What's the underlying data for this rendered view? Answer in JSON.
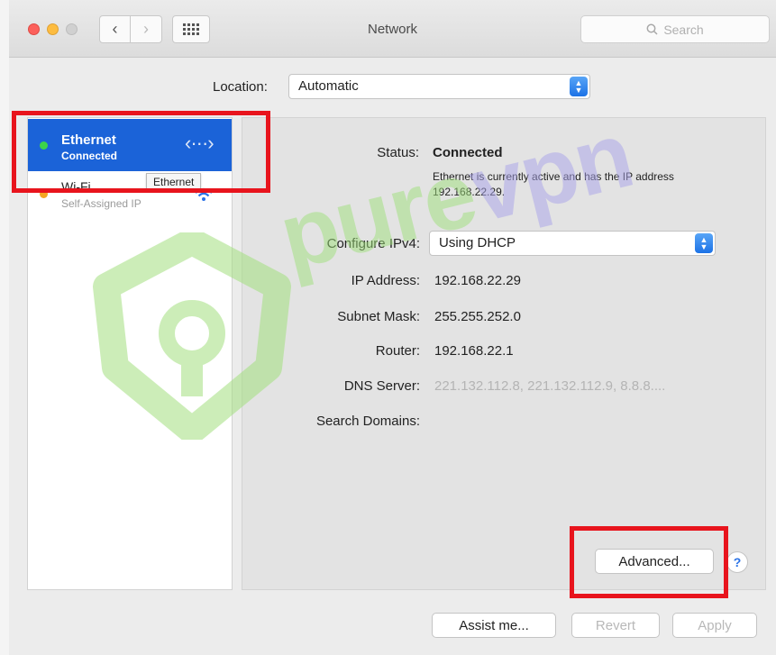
{
  "window": {
    "title": "Network"
  },
  "search": {
    "placeholder": "Search",
    "icon": "search-icon"
  },
  "location": {
    "label": "Location:",
    "value": "Automatic"
  },
  "services": [
    {
      "name": "Ethernet",
      "status": "Connected",
      "status_color": "#3cd44a",
      "icon": "ethernet-icon",
      "selected": true
    },
    {
      "name": "Wi-Fi",
      "status": "Self-Assigned IP",
      "status_color": "#f5a623",
      "icon": "wifi-icon",
      "selected": false
    }
  ],
  "tooltip": {
    "text": "Ethernet"
  },
  "details": {
    "status_label": "Status:",
    "status_value": "Connected",
    "status_description": "Ethernet is currently active and has the IP address 192.168.22.29.",
    "configure_label": "Configure IPv4:",
    "configure_value": "Using DHCP",
    "ip_label": "IP Address:",
    "ip_value": "192.168.22.29",
    "subnet_label": "Subnet Mask:",
    "subnet_value": "255.255.252.0",
    "router_label": "Router:",
    "router_value": "192.168.22.1",
    "dns_label": "DNS Server:",
    "dns_value": "221.132.112.8, 221.132.112.9, 8.8.8....",
    "search_domains_label": "Search Domains:"
  },
  "buttons": {
    "advanced": "Advanced...",
    "help": "?",
    "assist": "Assist me...",
    "revert": "Revert",
    "apply": "Apply"
  },
  "watermark": {
    "part1": "pure",
    "part2": "vpn"
  },
  "colors": {
    "selection": "#1b63d8",
    "highlight": "#e8141d",
    "accent": "#2a72e6"
  }
}
